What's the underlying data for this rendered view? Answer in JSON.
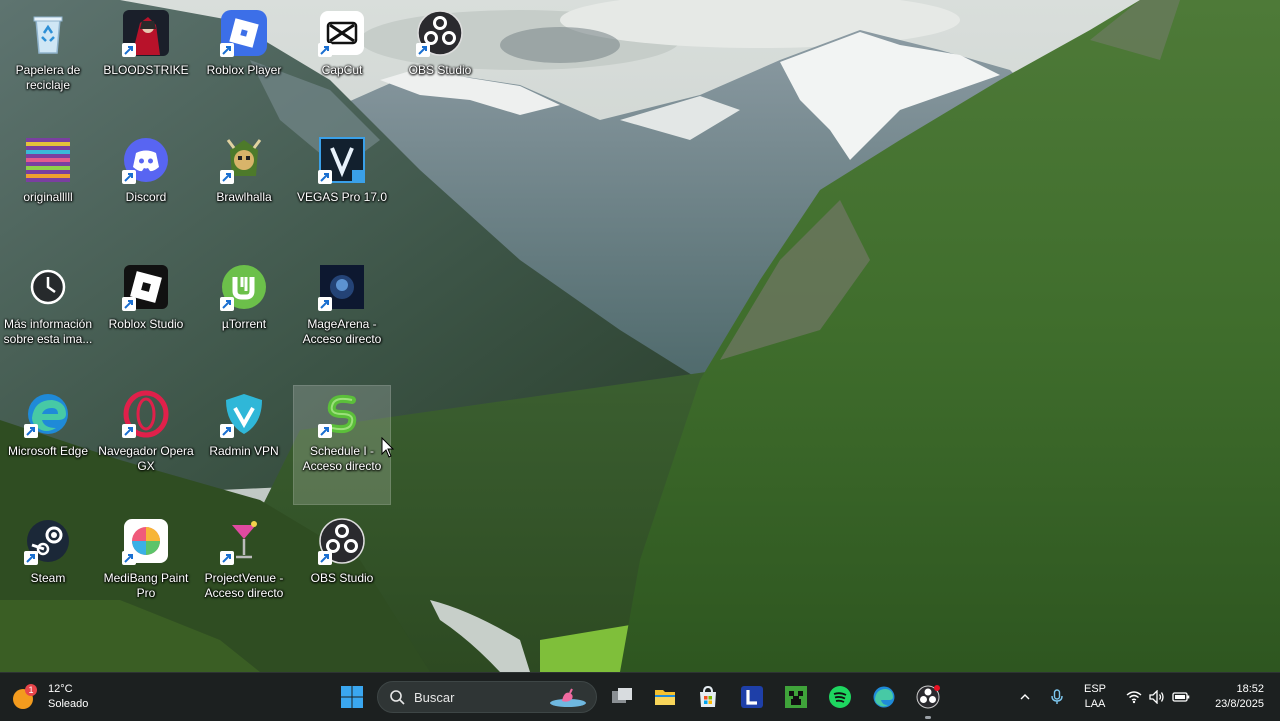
{
  "desktop": {
    "icons": [
      {
        "label": "Papelera de reciclaje",
        "icon": "recycle-bin-icon"
      },
      {
        "label": "BLOODSTRIKE",
        "icon": "bloodstrike-icon"
      },
      {
        "label": "Roblox Player",
        "icon": "roblox-player-icon"
      },
      {
        "label": "CapCut",
        "icon": "capcut-icon"
      },
      {
        "label": "OBS Studio",
        "icon": "obs-studio-icon"
      },
      {
        "label": "originalllll",
        "icon": "image-file-icon"
      },
      {
        "label": "Discord",
        "icon": "discord-icon"
      },
      {
        "label": "Brawlhalla",
        "icon": "brawlhalla-icon"
      },
      {
        "label": "VEGAS Pro 17.0",
        "icon": "vegas-pro-icon"
      },
      {
        "label": "Más información sobre esta ima...",
        "icon": "info-camera-icon"
      },
      {
        "label": "Roblox Studio",
        "icon": "roblox-studio-icon"
      },
      {
        "label": "µTorrent",
        "icon": "utorrent-icon"
      },
      {
        "label": "MageArena - Acceso directo",
        "icon": "magearena-icon"
      },
      {
        "label": "Microsoft Edge",
        "icon": "edge-icon"
      },
      {
        "label": "Navegador Opera GX",
        "icon": "opera-gx-icon"
      },
      {
        "label": "Radmin VPN",
        "icon": "radmin-vpn-icon"
      },
      {
        "label": "Schedule I - Acceso directo",
        "icon": "schedule-one-icon"
      },
      {
        "label": "Steam",
        "icon": "steam-icon"
      },
      {
        "label": "MediBang Paint Pro",
        "icon": "medibang-icon"
      },
      {
        "label": "ProjectVenue - Acceso directo",
        "icon": "cocktail-icon"
      },
      {
        "label": "OBS Studio",
        "icon": "obs-studio-icon"
      }
    ]
  },
  "taskbar": {
    "weather": {
      "temperature": "12°C",
      "condition": "Soleado",
      "alert_badge": "1",
      "icon": "sun-weather-icon"
    },
    "search": {
      "placeholder": "Buscar"
    },
    "pinned": [
      {
        "name": "start",
        "icon": "windows-start-icon"
      },
      {
        "name": "task-view",
        "icon": "task-view-icon"
      },
      {
        "name": "file-explorer",
        "icon": "folder-icon"
      },
      {
        "name": "microsoft-store",
        "icon": "store-icon"
      },
      {
        "name": "launcher-l",
        "icon": "l-app-icon"
      },
      {
        "name": "minecraft",
        "icon": "minecraft-icon"
      },
      {
        "name": "spotify",
        "icon": "spotify-icon"
      },
      {
        "name": "edge",
        "icon": "edge-icon"
      },
      {
        "name": "obs-studio",
        "icon": "obs-studio-icon"
      }
    ],
    "tray": {
      "language_line1": "ESP",
      "language_line2": "LAA",
      "time": "18:52",
      "date": "23/8/2025"
    }
  },
  "colors": {
    "taskbar_bg": "#1c2020",
    "accent": "#0078d4"
  }
}
